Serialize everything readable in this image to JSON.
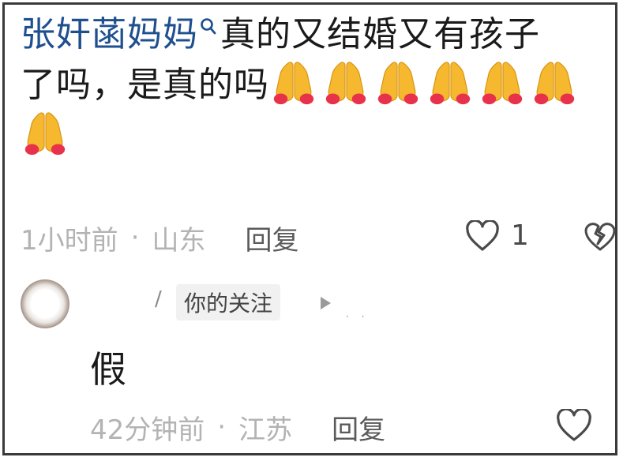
{
  "comment1": {
    "username": "张奸菡妈妈",
    "body_line1": "真的又结婚又有孩子",
    "body_line2": "了吗，是真的吗",
    "emoji_icon": "folded-hands-emoji",
    "emoji_count": 7,
    "time": "1小时前",
    "sep": "·",
    "location": "山东",
    "reply_label": "回复",
    "likes": "1"
  },
  "comment2": {
    "slash": "/",
    "follow_tag": "你的关注",
    "body": "假",
    "time": "42分钟前",
    "sep": "·",
    "location": "江苏",
    "reply_label": "回复"
  },
  "colors": {
    "username": "#1e4f8f",
    "meta": "#b3b3b3",
    "reply": "#5a5a5a"
  }
}
